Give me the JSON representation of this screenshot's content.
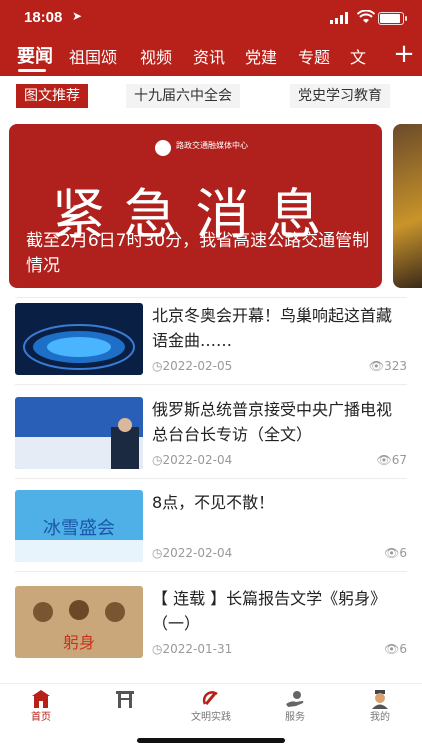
{
  "status_bar": {
    "time": "18:08"
  },
  "top_tabs": {
    "items": [
      "要闻",
      "祖国颂",
      "视频",
      "资讯",
      "党建",
      "专题",
      "文"
    ],
    "active": "要闻"
  },
  "sub_tabs": {
    "items": [
      "图文推荐",
      "十九届六中全会",
      "党史学习教育"
    ]
  },
  "banner": {
    "org_text": "路政交通融媒体中心",
    "headline": "紧急消息",
    "caption": "截至2月6日7时30分，我省高速公路交通管制情况"
  },
  "news": [
    {
      "title": "北京冬奥会开幕！鸟巢响起这首藏语金曲……",
      "date": "2022-02-05",
      "views": "323"
    },
    {
      "title": "俄罗斯总统普京接受中央广播电视总台台长专访（全文）",
      "date": "2022-02-04",
      "views": "67"
    },
    {
      "title": "8点，不见不散！",
      "date": "2022-02-04",
      "views": "6"
    },
    {
      "title": "【 连载 】长篇报告文学《躬身》（一）",
      "date": "2022-01-31",
      "views": "6"
    }
  ],
  "thumb_text": {
    "t3": "冰雪盛会",
    "t4": "躬身"
  },
  "bottom_nav": {
    "items": [
      "首页",
      "",
      "文明实践",
      "服务",
      "我的"
    ],
    "active": "首页"
  },
  "colors": {
    "brand_red": "#b8201a"
  }
}
